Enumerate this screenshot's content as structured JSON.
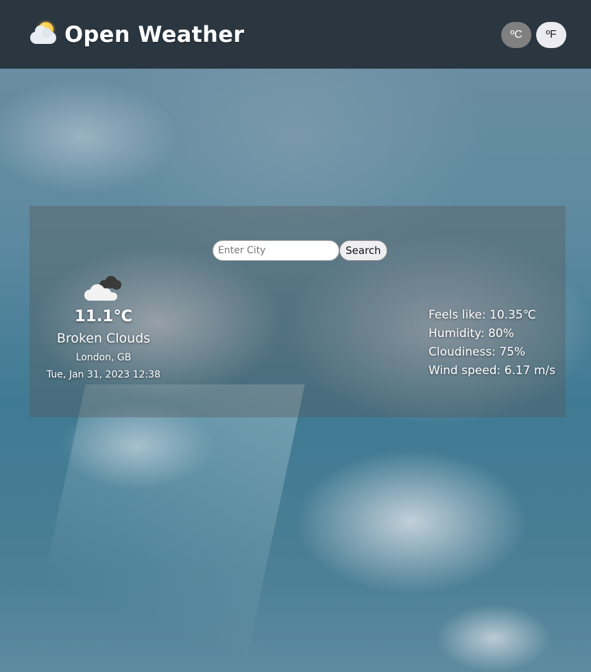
{
  "header": {
    "title": "Open Weather",
    "logo_icon": "sun-behind-cloud-icon",
    "units": [
      {
        "label": "ºC",
        "active": true
      },
      {
        "label": "ºF",
        "active": false
      }
    ]
  },
  "search": {
    "placeholder": "Enter City",
    "value": "",
    "button_label": "Search"
  },
  "current": {
    "icon": "broken-clouds-icon",
    "temperature": "11.1℃",
    "condition": "Broken Clouds",
    "location": "London, GB",
    "datetime": "Tue, Jan 31, 2023 12:38"
  },
  "details": {
    "feels_like": "Feels like: 10.35℃",
    "humidity": "Humidity: 80%",
    "cloudiness": "Cloudiness: 75%",
    "wind_speed": "Wind speed: 6.17 m/s"
  },
  "colors": {
    "header_bg": "#202830",
    "active_unit_bg": "#808080",
    "inactive_unit_bg": "#ececf0"
  }
}
